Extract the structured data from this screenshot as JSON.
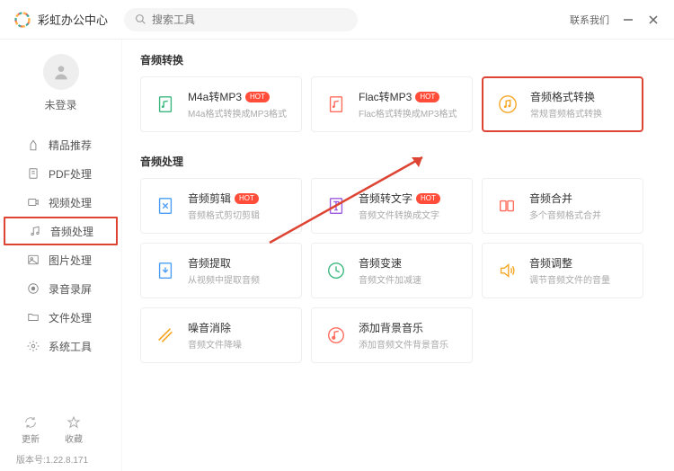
{
  "titlebar": {
    "app_name": "彩虹办公中心",
    "search_placeholder": "搜索工具",
    "contact": "联系我们"
  },
  "sidebar": {
    "login_status": "未登录",
    "items": [
      {
        "label": "精品推荐"
      },
      {
        "label": "PDF处理"
      },
      {
        "label": "视频处理"
      },
      {
        "label": "音频处理"
      },
      {
        "label": "图片处理"
      },
      {
        "label": "录音录屏"
      },
      {
        "label": "文件处理"
      },
      {
        "label": "系统工具"
      }
    ],
    "bottom": {
      "update": "更新",
      "favorite": "收藏"
    },
    "version": "版本号:1.22.8.171"
  },
  "sections": [
    {
      "title": "音频转换",
      "cards": [
        {
          "title": "M4a转MP3",
          "desc": "M4a格式转换成MP3格式",
          "hot": "HOT"
        },
        {
          "title": "Flac转MP3",
          "desc": "Flac格式转换成MP3格式",
          "hot": "HOT"
        },
        {
          "title": "音频格式转换",
          "desc": "常规音频格式转换",
          "hot": ""
        }
      ]
    },
    {
      "title": "音频处理",
      "cards": [
        {
          "title": "音频剪辑",
          "desc": "音频格式剪切剪辑",
          "hot": "HOT"
        },
        {
          "title": "音频转文字",
          "desc": "音频文件转换成文字",
          "hot": "HOT"
        },
        {
          "title": "音频合并",
          "desc": "多个音频格式合并",
          "hot": ""
        },
        {
          "title": "音频提取",
          "desc": "从视频中提取音频",
          "hot": ""
        },
        {
          "title": "音频变速",
          "desc": "音频文件加减速",
          "hot": ""
        },
        {
          "title": "音频调整",
          "desc": "调节音频文件的音量",
          "hot": ""
        },
        {
          "title": "噪音消除",
          "desc": "音频文件降噪",
          "hot": ""
        },
        {
          "title": "添加背景音乐",
          "desc": "添加音频文件背景音乐",
          "hot": ""
        }
      ]
    }
  ]
}
